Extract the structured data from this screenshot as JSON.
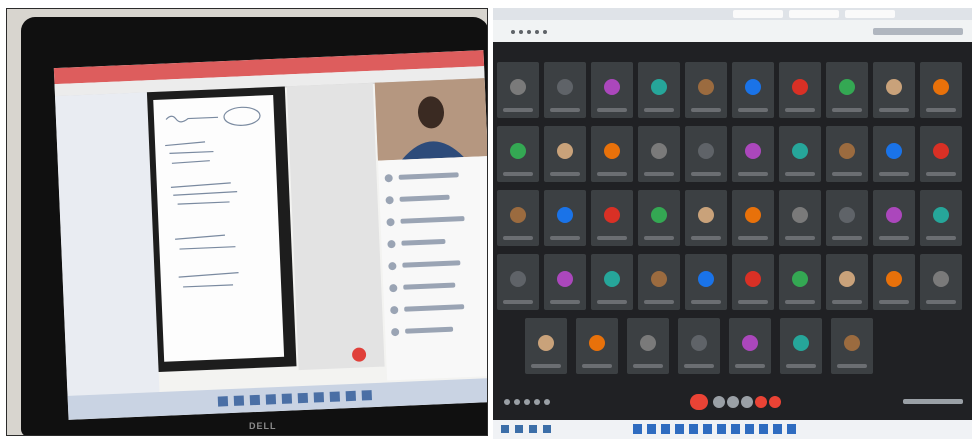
{
  "photo": {
    "brand": "DELL"
  },
  "meeting": {
    "participant_count": 47,
    "colors": {
      "tile": "#3c4043",
      "background": "#202124",
      "end_call": "#ea4335",
      "accent": "#4285f4"
    }
  }
}
